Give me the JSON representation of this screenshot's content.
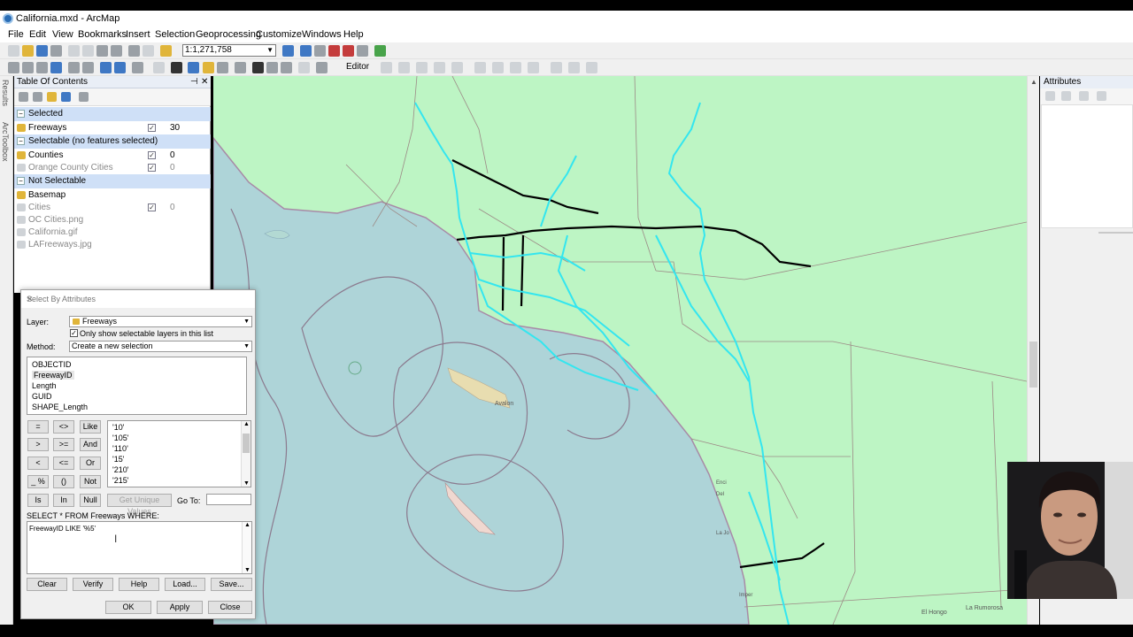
{
  "app": {
    "title": "California.mxd - ArcMap"
  },
  "menu": [
    "File",
    "Edit",
    "View",
    "Bookmarks",
    "Insert",
    "Selection",
    "Geoprocessing",
    "Customize",
    "Windows",
    "Help"
  ],
  "toolbar": {
    "scale": "1:1,271,758",
    "editor_label": "Editor"
  },
  "side_tabs": {
    "results": "Results",
    "arctoolbox": "ArcToolbox"
  },
  "toc": {
    "title": "Table Of Contents",
    "groups": {
      "selected": "Selected",
      "selectable": "Selectable (no features selected)",
      "not_selectable": "Not Selectable"
    },
    "layers": {
      "freeways": {
        "name": "Freeways",
        "count": "30"
      },
      "counties": {
        "name": "Counties",
        "count": "0"
      },
      "oc_cities": {
        "name": "Orange County Cities",
        "count": "0"
      },
      "basemap": {
        "name": "Basemap"
      },
      "cities": {
        "name": "Cities",
        "count": "0"
      },
      "oc_cities_png": {
        "name": "OC Cities.png"
      },
      "california_gif": {
        "name": "California.gif"
      },
      "lafreeways_jpg": {
        "name": "LAFreeways.jpg"
      }
    }
  },
  "attributes_panel": {
    "title": "Attributes"
  },
  "map_labels": {
    "avalon": "Avalon",
    "el_hongo": "El Hongo",
    "la_rumorosa": "La Rumorosa",
    "imperial": "Imper",
    "la_jolla": "La Jo",
    "encinitas": "Enci",
    "del_mar": "Del"
  },
  "dialog": {
    "title": "Select By Attributes",
    "layer_label": "Layer:",
    "layer_value": "Freeways",
    "only_selectable": "Only show selectable layers in this list",
    "method_label": "Method:",
    "method_value": "Create a new selection",
    "fields": [
      "OBJECTID",
      "FreewayID",
      "Length",
      "GUID",
      "SHAPE_Length"
    ],
    "operators": {
      "eq": "=",
      "ne": "<>",
      "like": "Like",
      "gt": ">",
      "ge": ">=",
      "and": "And",
      "lt": "<",
      "le": "<=",
      "or": "Or",
      "pct": "_ %",
      "paren": "()",
      "not": "Not",
      "is": "Is",
      "in": "In",
      "null": "Null"
    },
    "values": [
      "'10'",
      "'105'",
      "'110'",
      "'15'",
      "'210'",
      "'215'"
    ],
    "get_unique_values": "Get Unique Values",
    "go_to": "Go To:",
    "query_header": "SELECT * FROM Freeways WHERE:",
    "query": "FreewayID LIKE '%5'",
    "buttons": {
      "clear": "Clear",
      "verify": "Verify",
      "help": "Help",
      "load": "Load...",
      "save": "Save...",
      "ok": "OK",
      "apply": "Apply",
      "close": "Close"
    }
  },
  "colors": {
    "land": "#bdf5c4",
    "ocean": "#aed4d8",
    "freeway": "#000000",
    "selected_freeway": "#33e6ef",
    "toc_group": "#cfe0f7"
  }
}
